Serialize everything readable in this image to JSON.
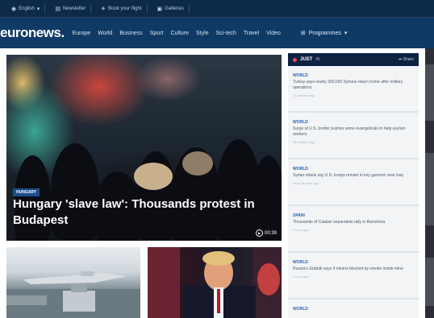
{
  "topbar": {
    "items": [
      {
        "icon": "globe-icon",
        "label": "English"
      },
      {
        "icon": "newsletter-icon",
        "label": "Newsletter"
      },
      {
        "icon": "plane-icon",
        "label": "Book your flight"
      },
      {
        "icon": "gallery-icon",
        "label": "Galleries"
      }
    ]
  },
  "nav": {
    "logo": "euronews.",
    "links": [
      "Europe",
      "World",
      "Business",
      "Sport",
      "Culture",
      "Style",
      "Sci-tech",
      "Travel",
      "Video"
    ],
    "programmes": "Programmes"
  },
  "hero": {
    "tag": "HUNGARY",
    "title": "Hungary 'slave law': Thousands protest in Budapest",
    "media_duration": "00:39"
  },
  "sidebar": {
    "title": "JUST",
    "subtitle": "IN",
    "share": "Share",
    "items": [
      {
        "category": "WORLD",
        "text": "Turkey says nearly 300,000 Syrians return home after military operations",
        "time": "13 minutes ago"
      },
      {
        "category": "WORLD",
        "text": "Surge at U.S. border pushes some evangelicals to help asylum seekers",
        "time": "26 minutes ago"
      },
      {
        "category": "WORLD",
        "text": "Syrian rebels say U.S. troops remain in key garrison near Iraq",
        "time": "about an hour ago"
      },
      {
        "category": "SPAIN",
        "text": "Thousands of Catalan separatists rally in Barcelona",
        "time": "1 hour ago"
      },
      {
        "category": "WORLD",
        "text": "Russia's Grabak says 9 miners blocked by smoke inside mine",
        "time": "1 hour ago"
      },
      {
        "category": "WORLD",
        "text": "",
        "time": ""
      }
    ]
  },
  "colors": {
    "topbar_bg": "#0d2a4a",
    "nav_bg": "#0f3a66",
    "accent_blue": "#2e63b1",
    "just_in_dot": "#e84a5f"
  }
}
